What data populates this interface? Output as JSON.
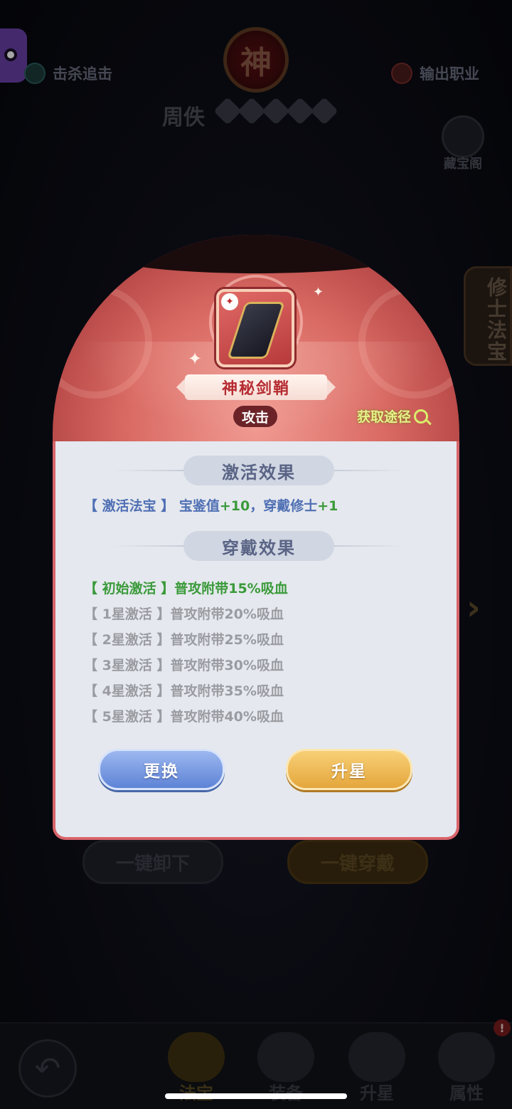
{
  "top": {
    "skill_left": "击杀追击",
    "skill_right": "输出职业",
    "god_seal": "神",
    "hero_name": "周佚",
    "star_count": 5,
    "treasure_label": "藏宝阁",
    "side_tab": "修士法宝"
  },
  "background_buttons": {
    "unload_all": "一键卸下",
    "wear_all": "一键穿戴"
  },
  "bottom_nav": {
    "tabs": [
      {
        "label": "法宝",
        "icon": "treasure-icon",
        "active": true
      },
      {
        "label": "装备",
        "icon": "equipment-icon",
        "active": false
      },
      {
        "label": "升星",
        "icon": "upstar-icon",
        "active": false
      },
      {
        "label": "属性",
        "icon": "attribute-icon",
        "active": false
      }
    ],
    "badge": "!"
  },
  "dialog": {
    "item_name": "神秘剑鞘",
    "item_type": "攻击",
    "obtain_link": "获取途径",
    "activate_section": "激活效果",
    "activate_effect_tag": "【 激活法宝 】",
    "activate_effect_text": "宝鉴值",
    "activate_effect_value1": "+10",
    "activate_effect_sep": "，穿戴修士",
    "activate_effect_value2": "+1",
    "wear_section": "穿戴效果",
    "wear_effects": [
      {
        "tag": "【 初始激活 】",
        "text": "普攻附带15%吸血",
        "unlocked": true
      },
      {
        "tag": "【 1星激活 】",
        "text": "普攻附带20%吸血",
        "unlocked": false
      },
      {
        "tag": "【 2星激活 】",
        "text": "普攻附带25%吸血",
        "unlocked": false
      },
      {
        "tag": "【 3星激活 】",
        "text": "普攻附带30%吸血",
        "unlocked": false
      },
      {
        "tag": "【 4星激活 】",
        "text": "普攻附带35%吸血",
        "unlocked": false
      },
      {
        "tag": "【 5星激活 】",
        "text": "普攻附带40%吸血",
        "unlocked": false
      }
    ],
    "change_button": "更换",
    "upstar_button": "升星"
  },
  "colors": {
    "header_red": "#d96a63",
    "body_bg": "#e5e8ee",
    "blue_text": "#4f6fb4",
    "green_text": "#3a9a3a",
    "gray_text": "#9a9ca2",
    "blue_button": "#5e84d6",
    "gold_button": "#e4a63c"
  }
}
